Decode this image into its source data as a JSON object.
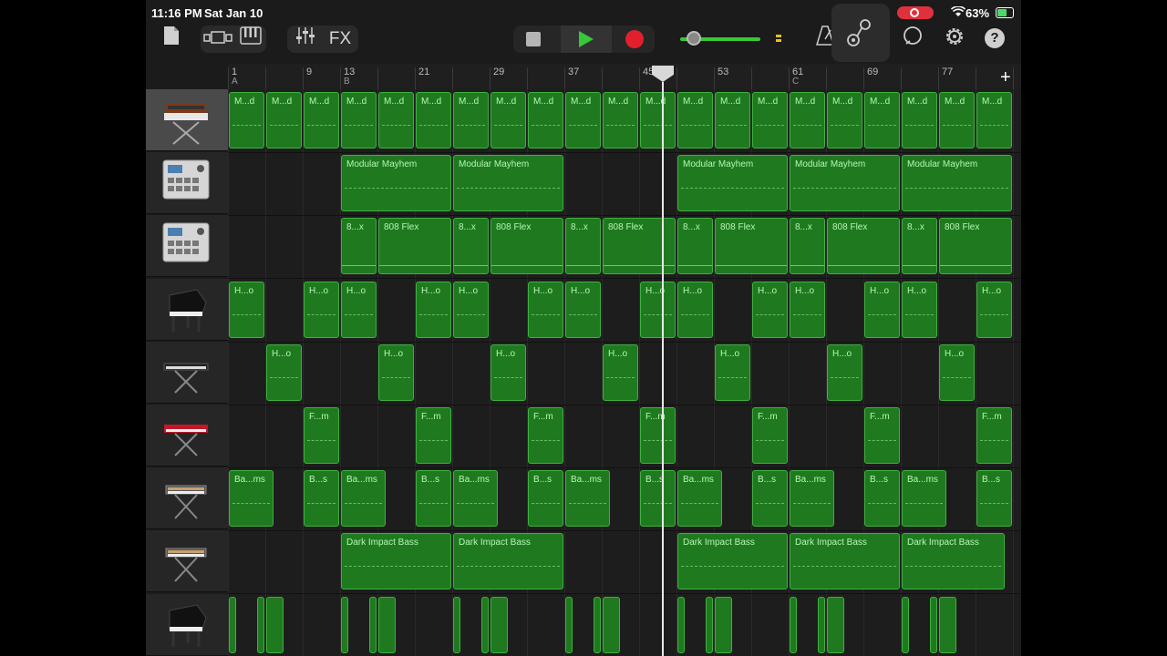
{
  "status": {
    "time": "11:16 PM",
    "date": "Sat Jan 10",
    "battery": "63%"
  },
  "toolbar": {
    "fx": "FX",
    "help": "?"
  },
  "colors": {
    "region": "#1f7a1f",
    "region_border": "#3fb03f",
    "play": "#37c837",
    "record": "#e2202c"
  },
  "ruler": {
    "bars": [
      {
        "n": "1",
        "sec": "A"
      },
      {
        "n": "9",
        "sec": ""
      },
      {
        "n": "13",
        "sec": "B"
      },
      {
        "n": "21",
        "sec": ""
      },
      {
        "n": "29",
        "sec": ""
      },
      {
        "n": "37",
        "sec": ""
      },
      {
        "n": "45",
        "sec": ""
      },
      {
        "n": "53",
        "sec": ""
      },
      {
        "n": "61",
        "sec": "C"
      },
      {
        "n": "69",
        "sec": ""
      },
      {
        "n": "77",
        "sec": ""
      }
    ]
  },
  "tracks": [
    {
      "icon": "synth-keyboard-icon",
      "selected": true,
      "regions": [
        {
          "name": "M...d",
          "cell": 0,
          "span": 1
        },
        {
          "name": "M...d",
          "cell": 1,
          "span": 1
        },
        {
          "name": "M...d",
          "cell": 2,
          "span": 1
        },
        {
          "name": "M...d",
          "cell": 3,
          "span": 1
        },
        {
          "name": "M...d",
          "cell": 4,
          "span": 1
        },
        {
          "name": "M...d",
          "cell": 5,
          "span": 1
        },
        {
          "name": "M...d",
          "cell": 6,
          "span": 1
        },
        {
          "name": "M...d",
          "cell": 7,
          "span": 1
        },
        {
          "name": "M...d",
          "cell": 8,
          "span": 1
        },
        {
          "name": "M...d",
          "cell": 9,
          "span": 1
        },
        {
          "name": "M...d",
          "cell": 10,
          "span": 1
        },
        {
          "name": "M...d",
          "cell": 11,
          "span": 1
        },
        {
          "name": "M...d",
          "cell": 12,
          "span": 1
        },
        {
          "name": "M...d",
          "cell": 13,
          "span": 1
        },
        {
          "name": "M...d",
          "cell": 14,
          "span": 1
        },
        {
          "name": "M...d",
          "cell": 15,
          "span": 1
        },
        {
          "name": "M...d",
          "cell": 16,
          "span": 1
        },
        {
          "name": "M...d",
          "cell": 17,
          "span": 1
        },
        {
          "name": "M...d",
          "cell": 18,
          "span": 1
        },
        {
          "name": "M...d",
          "cell": 19,
          "span": 1
        },
        {
          "name": "M...d",
          "cell": 20,
          "span": 1
        }
      ]
    },
    {
      "icon": "drum-machine-icon",
      "selected": false,
      "regions": [
        {
          "name": "Modular Mayhem",
          "cell": 3,
          "span": 3
        },
        {
          "name": "Modular Mayhem",
          "cell": 6,
          "span": 3
        },
        {
          "name": "Modular Mayhem",
          "cell": 12,
          "span": 3
        },
        {
          "name": "Modular Mayhem",
          "cell": 15,
          "span": 3
        },
        {
          "name": "Modular Mayhem",
          "cell": 18,
          "span": 3
        }
      ]
    },
    {
      "icon": "drum-machine-icon",
      "selected": false,
      "regions": [
        {
          "name": "8...x",
          "cell": 3,
          "span": 1
        },
        {
          "name": "808 Flex",
          "cell": 4,
          "span": 2
        },
        {
          "name": "8...x",
          "cell": 6,
          "span": 1
        },
        {
          "name": "808 Flex",
          "cell": 7,
          "span": 2
        },
        {
          "name": "8...x",
          "cell": 9,
          "span": 1
        },
        {
          "name": "808 Flex",
          "cell": 10,
          "span": 2
        },
        {
          "name": "8...x",
          "cell": 12,
          "span": 1
        },
        {
          "name": "808 Flex",
          "cell": 13,
          "span": 2
        },
        {
          "name": "8...x",
          "cell": 15,
          "span": 1
        },
        {
          "name": "808 Flex",
          "cell": 16,
          "span": 2
        },
        {
          "name": "8...x",
          "cell": 18,
          "span": 1
        },
        {
          "name": "808 Flex",
          "cell": 19,
          "span": 2
        }
      ]
    },
    {
      "icon": "grand-piano-icon",
      "selected": false,
      "regions": [
        {
          "name": "H...o",
          "cell": 0,
          "span": 1
        },
        {
          "name": "H...o",
          "cell": 2,
          "span": 1
        },
        {
          "name": "H...o",
          "cell": 3,
          "span": 1
        },
        {
          "name": "H...o",
          "cell": 5,
          "span": 1
        },
        {
          "name": "H...o",
          "cell": 6,
          "span": 1
        },
        {
          "name": "H...o",
          "cell": 8,
          "span": 1
        },
        {
          "name": "H...o",
          "cell": 9,
          "span": 1
        },
        {
          "name": "H...o",
          "cell": 11,
          "span": 1
        },
        {
          "name": "H...o",
          "cell": 12,
          "span": 1
        },
        {
          "name": "H...o",
          "cell": 14,
          "span": 1
        },
        {
          "name": "H...o",
          "cell": 15,
          "span": 1
        },
        {
          "name": "H...o",
          "cell": 17,
          "span": 1
        },
        {
          "name": "H...o",
          "cell": 18,
          "span": 1
        },
        {
          "name": "H...o",
          "cell": 20,
          "span": 1
        }
      ]
    },
    {
      "icon": "keyboard-icon",
      "selected": false,
      "regions": [
        {
          "name": "H...o",
          "cell": 1,
          "span": 1
        },
        {
          "name": "H...o",
          "cell": 4,
          "span": 1
        },
        {
          "name": "H...o",
          "cell": 7,
          "span": 1
        },
        {
          "name": "H...o",
          "cell": 10,
          "span": 1
        },
        {
          "name": "H...o",
          "cell": 13,
          "span": 1
        },
        {
          "name": "H...o",
          "cell": 16,
          "span": 1
        },
        {
          "name": "H...o",
          "cell": 19,
          "span": 1
        }
      ]
    },
    {
      "icon": "red-synth-icon",
      "selected": false,
      "regions": [
        {
          "name": "F...m",
          "cell": 2,
          "span": 1
        },
        {
          "name": "F...m",
          "cell": 5,
          "span": 1
        },
        {
          "name": "F...m",
          "cell": 8,
          "span": 1
        },
        {
          "name": "F...m",
          "cell": 11,
          "span": 1
        },
        {
          "name": "F...m",
          "cell": 14,
          "span": 1
        },
        {
          "name": "F...m",
          "cell": 17,
          "span": 1
        },
        {
          "name": "F...m",
          "cell": 20,
          "span": 1
        }
      ]
    },
    {
      "icon": "bass-synth-icon",
      "selected": false,
      "regions": [
        {
          "name": "Ba...ms",
          "cell": 0,
          "span": 1.25
        },
        {
          "name": "B...s",
          "cell": 2,
          "span": 1
        },
        {
          "name": "Ba...ms",
          "cell": 3,
          "span": 1.25
        },
        {
          "name": "B...s",
          "cell": 5,
          "span": 1
        },
        {
          "name": "Ba...ms",
          "cell": 6,
          "span": 1.25
        },
        {
          "name": "B...s",
          "cell": 8,
          "span": 1
        },
        {
          "name": "Ba...ms",
          "cell": 9,
          "span": 1.25
        },
        {
          "name": "B...s",
          "cell": 11,
          "span": 1
        },
        {
          "name": "Ba...ms",
          "cell": 12,
          "span": 1.25
        },
        {
          "name": "B...s",
          "cell": 14,
          "span": 1
        },
        {
          "name": "Ba...ms",
          "cell": 15,
          "span": 1.25
        },
        {
          "name": "B...s",
          "cell": 17,
          "span": 1
        },
        {
          "name": "Ba...ms",
          "cell": 18,
          "span": 1.25
        },
        {
          "name": "B...s",
          "cell": 20,
          "span": 1
        }
      ]
    },
    {
      "icon": "bass-synth-icon",
      "selected": false,
      "regions": [
        {
          "name": "Dark Impact Bass",
          "cell": 3,
          "span": 3
        },
        {
          "name": "Dark Impact Bass",
          "cell": 6,
          "span": 3
        },
        {
          "name": "Dark Impact Bass",
          "cell": 12,
          "span": 3
        },
        {
          "name": "Dark Impact Bass",
          "cell": 15,
          "span": 3
        },
        {
          "name": "Dark Impact Bass",
          "cell": 18,
          "span": 2.8
        }
      ]
    },
    {
      "icon": "grand-piano-icon",
      "selected": false,
      "regions": [
        {
          "name": "",
          "cell": 0,
          "span": 0.25
        },
        {
          "name": "",
          "cell": 0.75,
          "span": 0.25
        },
        {
          "name": "",
          "cell": 1,
          "span": 0.5
        },
        {
          "name": "",
          "cell": 3,
          "span": 0.25
        },
        {
          "name": "",
          "cell": 3.75,
          "span": 0.25
        },
        {
          "name": "",
          "cell": 4,
          "span": 0.5
        },
        {
          "name": "",
          "cell": 6,
          "span": 0.25
        },
        {
          "name": "",
          "cell": 6.75,
          "span": 0.25
        },
        {
          "name": "",
          "cell": 7,
          "span": 0.5
        },
        {
          "name": "",
          "cell": 9,
          "span": 0.25
        },
        {
          "name": "",
          "cell": 9.75,
          "span": 0.25
        },
        {
          "name": "",
          "cell": 10,
          "span": 0.5
        },
        {
          "name": "",
          "cell": 12,
          "span": 0.25
        },
        {
          "name": "",
          "cell": 12.75,
          "span": 0.25
        },
        {
          "name": "",
          "cell": 13,
          "span": 0.5
        },
        {
          "name": "",
          "cell": 15,
          "span": 0.25
        },
        {
          "name": "",
          "cell": 15.75,
          "span": 0.25
        },
        {
          "name": "",
          "cell": 16,
          "span": 0.5
        },
        {
          "name": "",
          "cell": 18,
          "span": 0.25
        },
        {
          "name": "",
          "cell": 18.75,
          "span": 0.25
        },
        {
          "name": "",
          "cell": 19,
          "span": 0.5
        }
      ]
    }
  ]
}
